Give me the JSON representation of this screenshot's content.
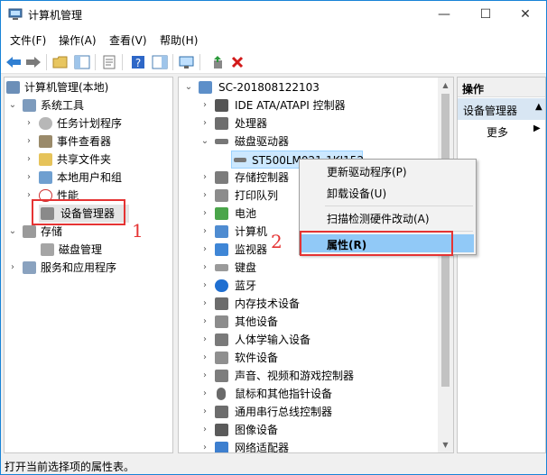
{
  "window": {
    "title": "计算机管理",
    "minimize": "—",
    "maximize": "☐",
    "close": "✕"
  },
  "menu": [
    "文件(F)",
    "操作(A)",
    "查看(V)",
    "帮助(H)"
  ],
  "left_tree": {
    "root": "计算机管理(本地)",
    "system_tools": "系统工具",
    "task_scheduler": "任务计划程序",
    "event_viewer": "事件查看器",
    "shared_folders": "共享文件夹",
    "local_users": "本地用户和组",
    "performance": "性能",
    "device_manager": "设备管理器",
    "storage": "存储",
    "disk_management": "磁盘管理",
    "services": "服务和应用程序"
  },
  "device_tree": {
    "computer": "SC-201808122103",
    "ide": "IDE ATA/ATAPI 控制器",
    "processor": "处理器",
    "disk_drives": "磁盘驱动器",
    "disk_item": "ST500LM021-1KJ152",
    "storage_ctrl": "存储控制器",
    "print_queue": "打印队列",
    "battery": "电池",
    "computer_node": "计算机",
    "monitor": "监视器",
    "keyboard": "键盘",
    "bluetooth": "蓝牙",
    "memory": "内存技术设备",
    "other": "其他设备",
    "hid": "人体学输入设备",
    "software": "软件设备",
    "sound": "声音、视频和游戏控制器",
    "mouse": "鼠标和其他指针设备",
    "usb": "通用串行总线控制器",
    "imaging": "图像设备",
    "network": "网络适配器"
  },
  "actions": {
    "header": "操作",
    "section": "设备管理器",
    "more": "更多"
  },
  "context_menu": {
    "update_driver": "更新驱动程序(P)",
    "uninstall": "卸载设备(U)",
    "scan": "扫描检测硬件改动(A)",
    "properties": "属性(R)"
  },
  "annotations": {
    "one": "1",
    "two": "2"
  },
  "status": "打开当前选择项的属性表。",
  "colors": {
    "accent": "#1883d7",
    "highlight": "#91c9f7",
    "annotation": "#e53333",
    "selected": "#cce8ff"
  }
}
